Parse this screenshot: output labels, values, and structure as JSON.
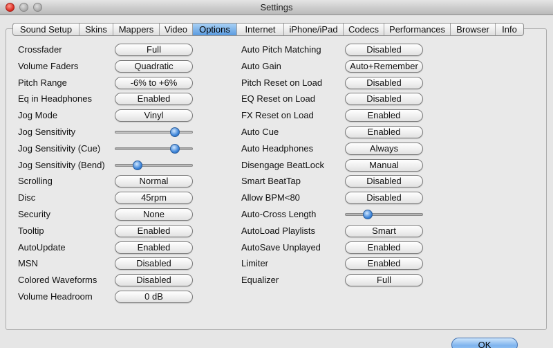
{
  "window": {
    "title": "Settings"
  },
  "tabs": [
    {
      "label": "Sound Setup",
      "active": false
    },
    {
      "label": "Skins",
      "active": false
    },
    {
      "label": "Mappers",
      "active": false
    },
    {
      "label": "Video",
      "active": false
    },
    {
      "label": "Options",
      "active": true
    },
    {
      "label": "Internet",
      "active": false
    },
    {
      "label": "iPhone/iPad",
      "active": false
    },
    {
      "label": "Codecs",
      "active": false
    },
    {
      "label": "Performances",
      "active": false
    },
    {
      "label": "Browser",
      "active": false
    },
    {
      "label": "Info",
      "active": false
    }
  ],
  "left_options": [
    {
      "label": "Crossfader",
      "kind": "button",
      "value": "Full"
    },
    {
      "label": "Volume Faders",
      "kind": "button",
      "value": "Quadratic"
    },
    {
      "label": "Pitch Range",
      "kind": "button",
      "value": "-6% to +6%"
    },
    {
      "label": "Eq in Headphones",
      "kind": "button",
      "value": "Enabled"
    },
    {
      "label": "Jog Mode",
      "kind": "button",
      "value": "Vinyl"
    },
    {
      "label": "Jog Sensitivity",
      "kind": "slider",
      "value": 0.77
    },
    {
      "label": "Jog Sensitivity (Cue)",
      "kind": "slider",
      "value": 0.77
    },
    {
      "label": "Jog Sensitivity (Bend)",
      "kind": "slider",
      "value": 0.29
    },
    {
      "label": "Scrolling",
      "kind": "button",
      "value": "Normal"
    },
    {
      "label": "Disc",
      "kind": "button",
      "value": "45rpm"
    },
    {
      "label": "Security",
      "kind": "button",
      "value": "None"
    },
    {
      "label": "Tooltip",
      "kind": "button",
      "value": "Enabled"
    },
    {
      "label": "AutoUpdate",
      "kind": "button",
      "value": "Enabled"
    },
    {
      "label": "MSN",
      "kind": "button",
      "value": "Disabled"
    },
    {
      "label": "Colored Waveforms",
      "kind": "button",
      "value": "Disabled"
    },
    {
      "label": "Volume Headroom",
      "kind": "button",
      "value": "0 dB"
    }
  ],
  "right_options": [
    {
      "label": "Auto Pitch Matching",
      "kind": "button",
      "value": "Disabled"
    },
    {
      "label": "Auto Gain",
      "kind": "button",
      "value": "Auto+Remember"
    },
    {
      "label": "Pitch Reset on Load",
      "kind": "button",
      "value": "Disabled"
    },
    {
      "label": "EQ Reset on Load",
      "kind": "button",
      "value": "Disabled"
    },
    {
      "label": "FX Reset on Load",
      "kind": "button",
      "value": "Enabled"
    },
    {
      "label": "Auto Cue",
      "kind": "button",
      "value": "Enabled"
    },
    {
      "label": "Auto Headphones",
      "kind": "button",
      "value": "Always"
    },
    {
      "label": "Disengage BeatLock",
      "kind": "button",
      "value": "Manual"
    },
    {
      "label": "Smart BeatTap",
      "kind": "button",
      "value": "Disabled"
    },
    {
      "label": "Allow BPM<80",
      "kind": "button",
      "value": "Disabled"
    },
    {
      "label": "Auto-Cross Length",
      "kind": "slider",
      "value": 0.29
    },
    {
      "label": "AutoLoad Playlists",
      "kind": "button",
      "value": "Smart"
    },
    {
      "label": "AutoSave Unplayed",
      "kind": "button",
      "value": "Enabled"
    },
    {
      "label": "Limiter",
      "kind": "button",
      "value": "Enabled"
    },
    {
      "label": "Equalizer",
      "kind": "button",
      "value": "Full"
    }
  ],
  "footer": {
    "ok_label": "OK"
  }
}
